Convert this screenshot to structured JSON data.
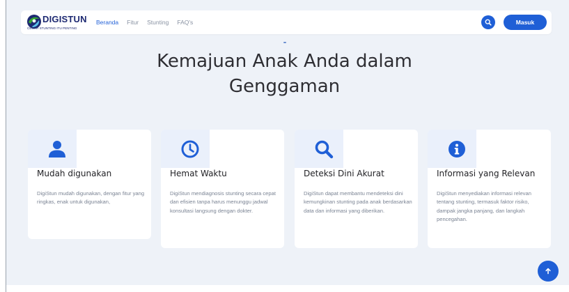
{
  "brand": {
    "name": "DIGISTUN",
    "tagline": "CEGAH STUNTING ITU PENTING"
  },
  "nav": {
    "links": [
      "Beranda",
      "Fitur",
      "Stunting",
      "FAQ's"
    ],
    "active": "Beranda",
    "login_label": "Masuk"
  },
  "hero": {
    "line1": "Kemajuan Anak Anda dalam",
    "line2": "Genggaman"
  },
  "cards": [
    {
      "icon": "user-icon",
      "title": "Mudah digunakan",
      "text": "DigiStun mudah digunakan, dengan fitur yang ringkas, enak untuk digunakan,"
    },
    {
      "icon": "clock-icon",
      "title": "Hemat Waktu",
      "text": "DigiStun mendiagnosis stunting secara cepat dan efisien tanpa harus menunggu jadwal konsultasi langsung dengan dokter."
    },
    {
      "icon": "search-icon",
      "title": "Deteksi Dini Akurat",
      "text": "DigiStun dapat membantu mendeteksi dini kemungkinan stunting pada anak berdasarkan data dan informasi yang diberikan."
    },
    {
      "icon": "info-icon",
      "title": "Informasi yang Relevan",
      "text": "DigiStun menyediakan informasi relevan tentang stunting, termasuk faktor risiko, dampak jangka panjang, dan langkah pencegahan."
    }
  ],
  "colors": {
    "primary": "#1f5fd6",
    "brand_navy": "#1e2a72",
    "logo_green": "#3aa935",
    "background": "#eef2f8",
    "icon_box": "#eaf0fb"
  }
}
